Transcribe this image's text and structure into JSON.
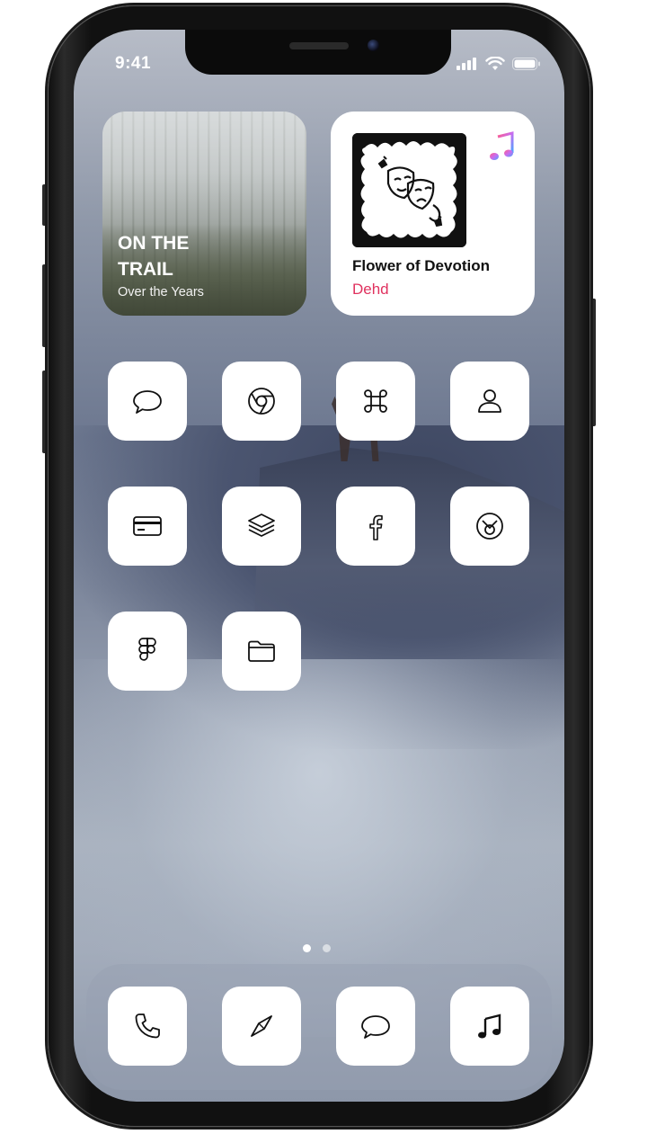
{
  "status_bar": {
    "time": "9:41",
    "icons": [
      "cellular-signal-icon",
      "wifi-icon",
      "battery-icon"
    ]
  },
  "photo_widget": {
    "title": "ON THE TRAIL",
    "subtitle": "Over the Years"
  },
  "music_widget": {
    "song": "Flower of Devotion",
    "artist": "Dehd",
    "artist_color": "#e0325f",
    "app_icon": "apple-music-icon"
  },
  "home_apps": [
    {
      "icon": "message-bubble-icon"
    },
    {
      "icon": "chrome-icon"
    },
    {
      "icon": "command-icon"
    },
    {
      "icon": "contact-person-icon"
    },
    {
      "icon": "wallet-card-icon"
    },
    {
      "icon": "layers-stack-icon"
    },
    {
      "icon": "facebook-icon"
    },
    {
      "icon": "circle-check-icon"
    },
    {
      "icon": "figma-icon"
    },
    {
      "icon": "folder-icon"
    }
  ],
  "page_indicator": {
    "pages": 2,
    "current": 1
  },
  "dock_apps": [
    {
      "icon": "phone-icon"
    },
    {
      "icon": "compass-icon"
    },
    {
      "icon": "message-bubble-icon"
    },
    {
      "icon": "music-note-icon"
    }
  ]
}
